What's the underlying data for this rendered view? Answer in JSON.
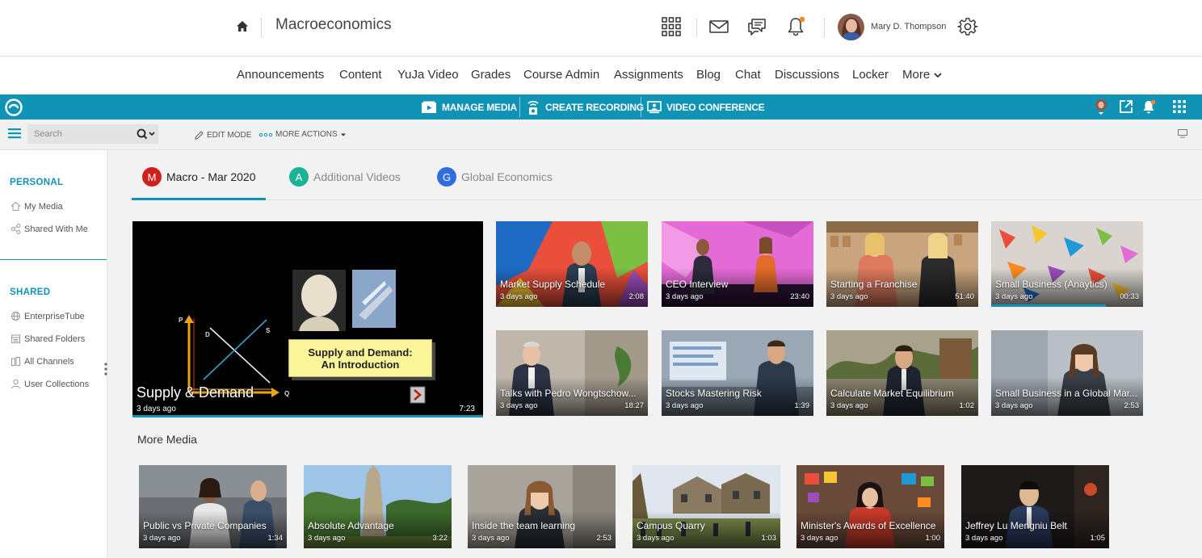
{
  "header": {
    "course_title": "Macroeconomics",
    "user_name": "Mary D. Thompson",
    "accent_notification": "#f08a24"
  },
  "course_nav": {
    "items": [
      "Announcements",
      "Content",
      "YuJa Video",
      "Grades",
      "Course Admin",
      "Assignments",
      "Blog",
      "Chat",
      "Discussions",
      "Locker",
      "More"
    ]
  },
  "yuja_bar": {
    "color": "#1193b6",
    "manage_media": "MANAGE MEDIA",
    "create_recording": "CREATE RECORDING",
    "video_conference": "VIDEO CONFERENCE"
  },
  "toolbar": {
    "search_placeholder": "Search",
    "edit_mode": "EDIT MODE",
    "more_actions": "MORE ACTIONS"
  },
  "sidebar": {
    "personal_heading": "PERSONAL",
    "personal_items": [
      "My Media",
      "Shared With Me"
    ],
    "shared_heading": "SHARED",
    "shared_items": [
      "EnterpriseTube",
      "Shared Folders",
      "All Channels",
      "User Collections"
    ]
  },
  "tabs": [
    {
      "letter": "M",
      "label": "Macro - Mar 2020",
      "color": "#d0201e",
      "active": true
    },
    {
      "letter": "A",
      "label": "Additional Videos",
      "color": "#1ab394",
      "active": false
    },
    {
      "letter": "G",
      "label": "Global Economics",
      "color": "#2f6de0",
      "active": false
    }
  ],
  "featured": {
    "title": "Supply & Demand",
    "date": "3 days ago",
    "duration": "7:23",
    "slide_line1": "Supply and Demand:",
    "slide_line2": "An Introduction",
    "axis_p": "P",
    "axis_q": "Q",
    "label_d": "D",
    "label_s": "S"
  },
  "grid_videos": [
    {
      "title": "Market Supply Schedule",
      "date": "3 days ago",
      "duration": "2:08"
    },
    {
      "title": "CEO Interview",
      "date": "3 days ago",
      "duration": "23:40"
    },
    {
      "title": "Starting a Franchise",
      "date": "3 days ago",
      "duration": "51:40"
    },
    {
      "title": "Small Business (Anaytics)",
      "date": "3 days ago",
      "duration": "00:33"
    },
    {
      "title": "Talks with Pedro Wongtschow...",
      "date": "3 days ago",
      "duration": "18:27"
    },
    {
      "title": "Stocks Mastering Risk",
      "date": "3 days ago",
      "duration": "1:39"
    },
    {
      "title": "Calculate Market Equilibrium",
      "date": "3 days ago",
      "duration": "1:02"
    },
    {
      "title": "Small Business in a Global Mar...",
      "date": "3 days ago",
      "duration": "2:53"
    }
  ],
  "more_media": {
    "heading": "More Media",
    "videos": [
      {
        "title": "Public vs Private Companies",
        "date": "3 days ago",
        "duration": "1:34"
      },
      {
        "title": "Absolute Advantage",
        "date": "3 days ago",
        "duration": "3:22"
      },
      {
        "title": "Inside the team learning",
        "date": "3 days ago",
        "duration": "2:53"
      },
      {
        "title": "Campus Quarry",
        "date": "3 days ago",
        "duration": "1:03"
      },
      {
        "title": "Minister's Awards of Excellence",
        "date": "3 days ago",
        "duration": "1:00"
      },
      {
        "title": "Jeffrey Lu Mengniu Belt",
        "date": "3 days ago",
        "duration": "1:05"
      }
    ]
  }
}
